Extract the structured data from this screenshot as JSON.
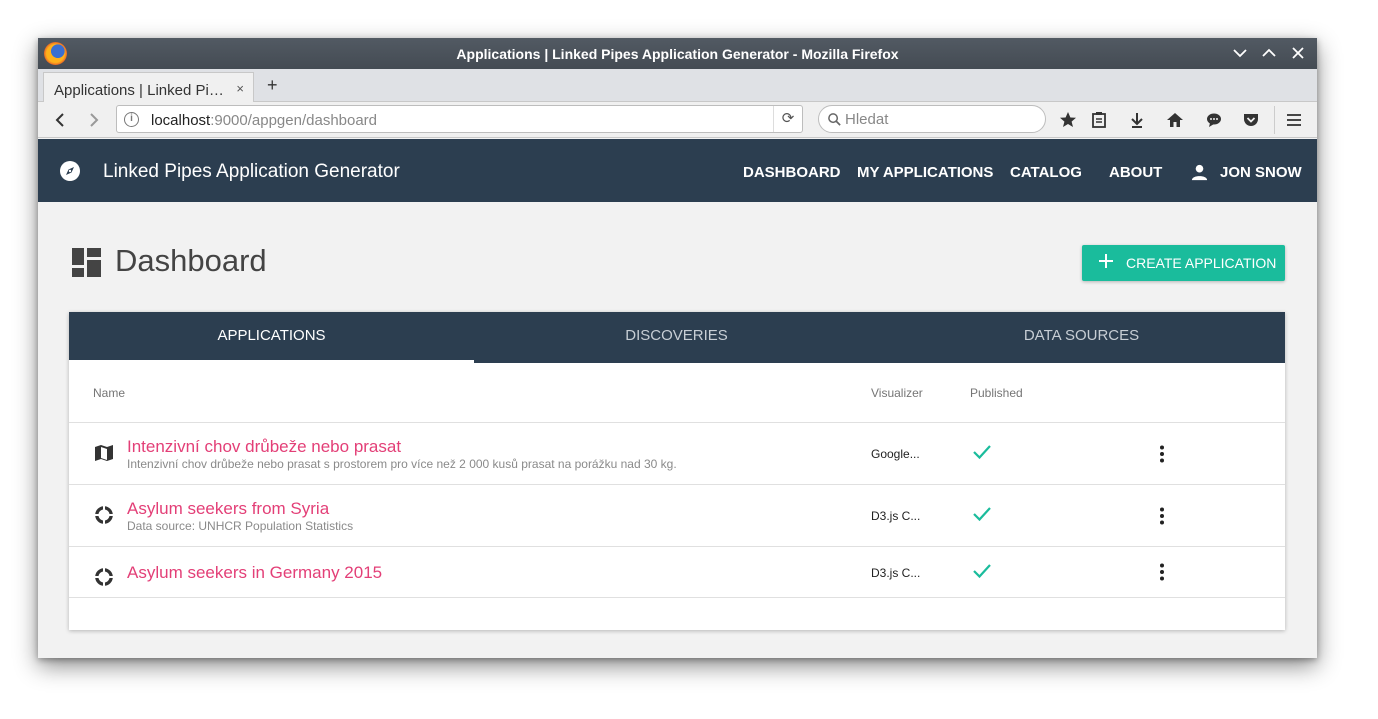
{
  "window": {
    "title": "Applications | Linked Pipes Application Generator - Mozilla Firefox"
  },
  "browser": {
    "tab_title": "Applications | Linked Pi…",
    "tab_close": "×",
    "new_tab": "+",
    "url_host": "localhost",
    "url_rest": ":9000/appgen/dashboard",
    "reload": "⟳",
    "search_placeholder": "Hledat"
  },
  "app": {
    "name": "Linked Pipes Application Generator",
    "nav": {
      "dashboard": "DASHBOARD",
      "my_applications": "MY APPLICATIONS",
      "catalog": "CATALOG",
      "about": "ABOUT",
      "user": "JON SNOW"
    }
  },
  "page": {
    "title": "Dashboard",
    "create_button": "CREATE APPLICATION"
  },
  "tabs": [
    {
      "label": "APPLICATIONS",
      "active": true
    },
    {
      "label": "DISCOVERIES",
      "active": false
    },
    {
      "label": "DATA SOURCES",
      "active": false
    }
  ],
  "table": {
    "headers": {
      "name": "Name",
      "visualizer": "Visualizer",
      "published": "Published"
    },
    "rows": [
      {
        "icon": "map-icon",
        "title": "Intenzivní chov drůbeže nebo prasat",
        "description": "Intenzivní chov drůbeže nebo prasat s prostorem pro více než 2 000 kusů prasat na porážku nad 30 kg.",
        "visualizer": "Google...",
        "published": true
      },
      {
        "icon": "donut-chart-icon",
        "title": "Asylum seekers from Syria",
        "description": "Data source: UNHCR Population Statistics",
        "visualizer": "D3.js C...",
        "published": true
      },
      {
        "icon": "donut-chart-icon",
        "title": "Asylum seekers in Germany 2015",
        "description": "",
        "visualizer": "D3.js C...",
        "published": true
      }
    ]
  },
  "colors": {
    "header_bg": "#2c3e50",
    "accent_teal": "#1abc9c",
    "link_pink": "#e33f77"
  }
}
